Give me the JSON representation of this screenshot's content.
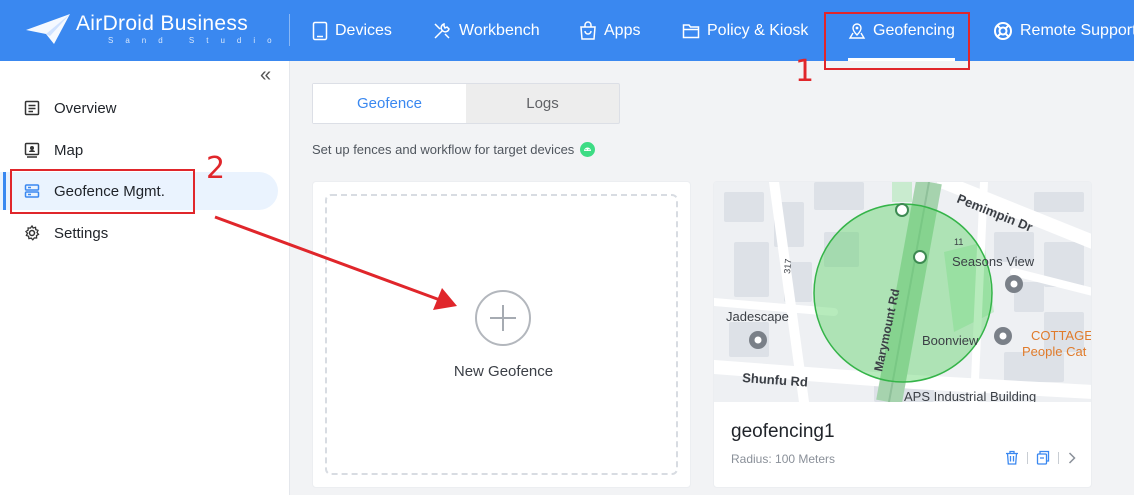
{
  "header": {
    "brand": "AirDroid Business",
    "brand_sub": "Sand Studio",
    "nav": [
      {
        "label": "Devices",
        "icon": "tablet-icon"
      },
      {
        "label": "Workbench",
        "icon": "tools-icon"
      },
      {
        "label": "Apps",
        "icon": "shopping-bag-icon"
      },
      {
        "label": "Policy & Kiosk",
        "icon": "folder-icon"
      },
      {
        "label": "Geofencing",
        "icon": "map-pin-icon",
        "active": true
      },
      {
        "label": "Remote Support",
        "icon": "lifebuoy-icon"
      }
    ]
  },
  "sidebar": {
    "collapse_glyph": "«",
    "items": [
      {
        "label": "Overview",
        "icon": "list-icon"
      },
      {
        "label": "Map",
        "icon": "map-icon"
      },
      {
        "label": "Geofence Mgmt.",
        "icon": "server-icon",
        "active": true
      },
      {
        "label": "Settings",
        "icon": "gear-icon"
      }
    ]
  },
  "main": {
    "tabs": [
      {
        "label": "Geofence",
        "active": true
      },
      {
        "label": "Logs"
      }
    ],
    "description": "Set up fences and workflow for target devices",
    "new_card": {
      "label": "New Geofence"
    },
    "geofence_card": {
      "name": "geofencing1",
      "radius": "Radius: 100 Meters",
      "map_labels": {
        "street_1": "Pemimpin Dr",
        "street_2": "Marymount Rd",
        "street_3": "Shunfu Rd",
        "place_1": "Seasons View",
        "place_2": "Jadescape",
        "place_3": "Boonview",
        "place_4": "COTTAGE",
        "place_5": "People Cat",
        "place_6": "APS Industrial Building",
        "num_1": "317",
        "num_2": "11"
      }
    }
  },
  "annotations": {
    "step_1": "1",
    "step_2": "2"
  },
  "colors": {
    "primary": "#3a88f0",
    "annotation": "#e0262b",
    "geofence_fill": "#5fd26a"
  }
}
